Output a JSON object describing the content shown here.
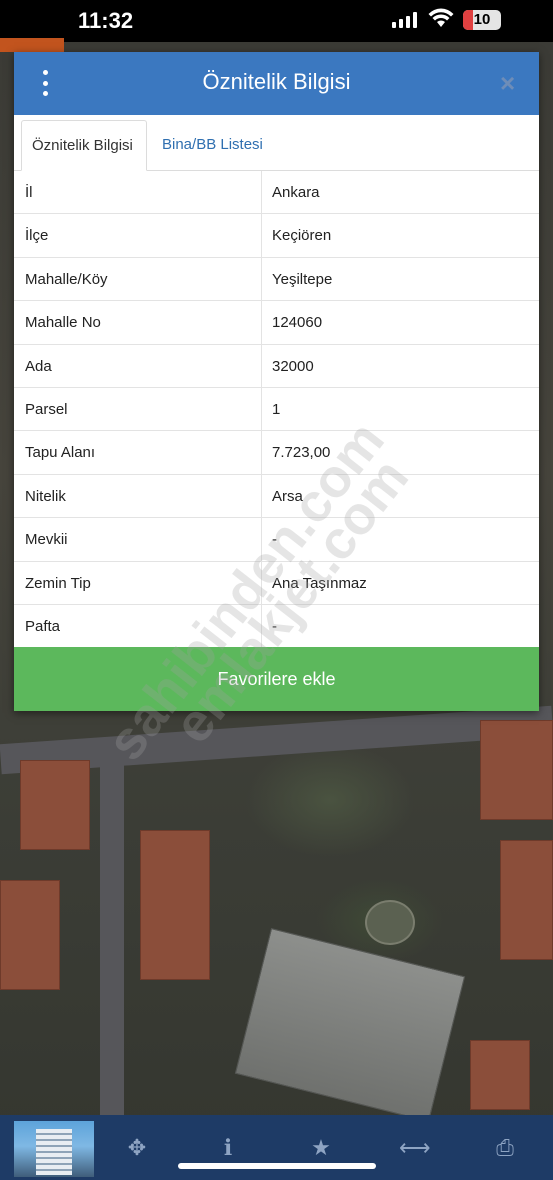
{
  "status_bar": {
    "time": "11:32",
    "battery": "10"
  },
  "dialog": {
    "title": "Öznitelik Bilgisi",
    "menu_icon": "kebab-menu-icon",
    "close_icon": "close-icon",
    "close_glyph": "×",
    "tabs": [
      {
        "label": "Öznitelik Bilgisi",
        "active": true
      },
      {
        "label": "Bina/BB Listesi",
        "active": false
      }
    ],
    "rows": [
      {
        "key": "İl",
        "value": "Ankara"
      },
      {
        "key": "İlçe",
        "value": "Keçiören"
      },
      {
        "key": "Mahalle/Köy",
        "value": "Yeşiltepe"
      },
      {
        "key": "Mahalle No",
        "value": "124060"
      },
      {
        "key": "Ada",
        "value": "32000"
      },
      {
        "key": "Parsel",
        "value": "1"
      },
      {
        "key": "Tapu Alanı",
        "value": "7.723,00"
      },
      {
        "key": "Nitelik",
        "value": "Arsa"
      },
      {
        "key": "Mevkii",
        "value": "-"
      },
      {
        "key": "Zemin Tip",
        "value": "Ana Taşınmaz"
      },
      {
        "key": "Pafta",
        "value": "-"
      }
    ],
    "favorite_button": "Favorilere ekle"
  },
  "watermarks": [
    "sahibinden.com",
    "emlakjet.com"
  ],
  "toolbar": {
    "icons": [
      "crosshair-icon",
      "info-icon",
      "star-icon",
      "measure-icon",
      "print-icon"
    ],
    "glyphs": [
      "✥",
      "ℹ",
      "★",
      "⟷",
      "⎙"
    ]
  },
  "colors": {
    "header": "#3b78c0",
    "button": "#5cb85c",
    "toolbar": "#1e3b66"
  }
}
